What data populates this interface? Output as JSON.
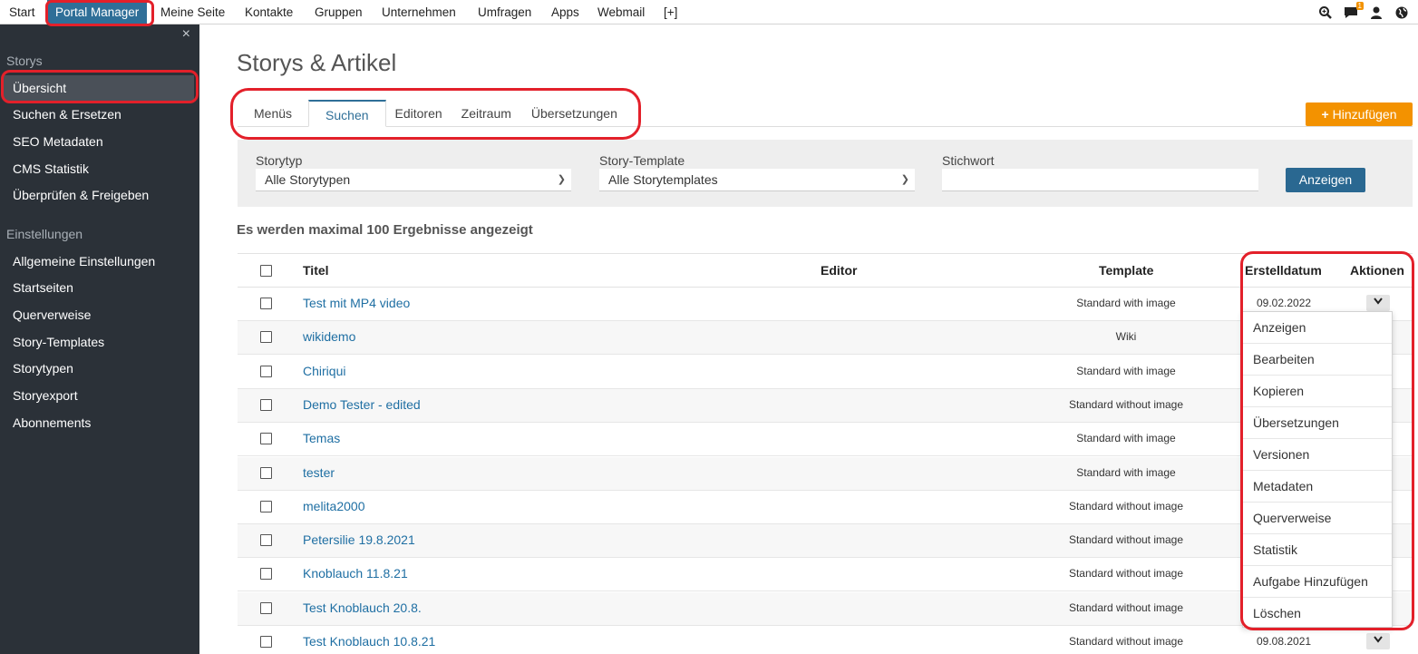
{
  "topnav": {
    "items": [
      "Start",
      "Portal Manager",
      "Meine Seite",
      "Kontakte",
      "Gruppen",
      "Unternehmen",
      "Umfragen",
      "Apps",
      "Webmail",
      "[+]"
    ],
    "notification_count": "1",
    "icons": [
      "search-icon",
      "chat-icon",
      "user-icon",
      "globe-icon"
    ]
  },
  "sidebar": {
    "sections": [
      {
        "title": "Storys",
        "items": [
          "Übersicht",
          "Suchen & Ersetzen",
          "SEO Metadaten",
          "CMS Statistik",
          "Überprüfen & Freigeben"
        ]
      },
      {
        "title": "Einstellungen",
        "items": [
          "Allgemeine Einstellungen",
          "Startseiten",
          "Querverweise",
          "Story-Templates",
          "Storytypen",
          "Storyexport",
          "Abonnements"
        ]
      }
    ],
    "close": "×"
  },
  "main": {
    "title": "Storys & Artikel",
    "tabs": [
      "Menüs",
      "Suchen",
      "Editoren",
      "Zeitraum",
      "Übersetzungen"
    ],
    "add_button": "Hinzufügen",
    "filter": {
      "storytyp_label": "Storytyp",
      "storytyp_value": "Alle Storytypen",
      "template_label": "Story-Template",
      "template_value": "Alle Storytemplates",
      "keyword_label": "Stichwort",
      "keyword_value": "",
      "show_button": "Anzeigen"
    },
    "results_info": "Es werden maximal 100 Ergebnisse angezeigt",
    "table": {
      "headers": {
        "title": "Titel",
        "editor": "Editor",
        "template": "Template",
        "date": "Erstelldatum",
        "actions": "Aktionen"
      },
      "rows": [
        {
          "title": "Test mit MP4 video",
          "template": "Standard with image",
          "date": "09.02.2022"
        },
        {
          "title": "wikidemo",
          "template": "Wiki",
          "date": ""
        },
        {
          "title": "Chiriqui",
          "template": "Standard with image",
          "date": ""
        },
        {
          "title": "Demo Tester - edited",
          "template": "Standard without image",
          "date": ""
        },
        {
          "title": "Temas",
          "template": "Standard with image",
          "date": ""
        },
        {
          "title": "tester",
          "template": "Standard with image",
          "date": ""
        },
        {
          "title": "melita2000",
          "template": "Standard without image",
          "date": ""
        },
        {
          "title": "Petersilie 19.8.2021",
          "template": "Standard without image",
          "date": ""
        },
        {
          "title": "Knoblauch 11.8.21",
          "template": "Standard without image",
          "date": ""
        },
        {
          "title": "Test Knoblauch 20.8.",
          "template": "Standard without image",
          "date": ""
        },
        {
          "title": "Test Knoblauch 10.8.21",
          "template": "Standard without image",
          "date": "09.08.2021"
        }
      ]
    },
    "action_menu": [
      "Anzeigen",
      "Bearbeiten",
      "Kopieren",
      "Übersetzungen",
      "Versionen",
      "Metadaten",
      "Querverweise",
      "Statistik",
      "Aufgabe Hinzufügen",
      "Löschen"
    ]
  },
  "colors": {
    "accent": "#2f6f98",
    "add_button": "#f39200",
    "sidebar_bg": "#2b3138",
    "link": "#1f6fa3",
    "highlight": "#e3202a"
  }
}
